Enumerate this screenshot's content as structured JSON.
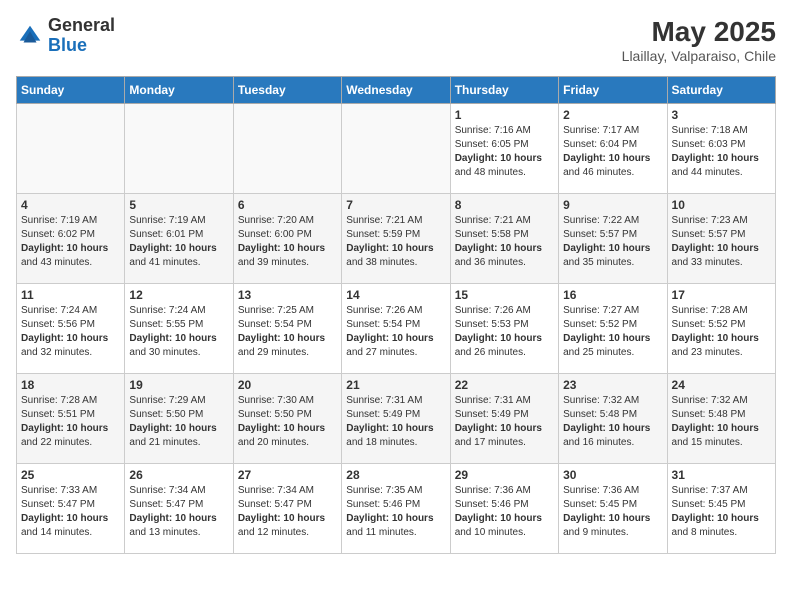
{
  "header": {
    "logo_general": "General",
    "logo_blue": "Blue",
    "title": "May 2025",
    "subtitle": "Llaillay, Valparaiso, Chile"
  },
  "weekdays": [
    "Sunday",
    "Monday",
    "Tuesday",
    "Wednesday",
    "Thursday",
    "Friday",
    "Saturday"
  ],
  "weeks": [
    [
      {
        "day": "",
        "info": ""
      },
      {
        "day": "",
        "info": ""
      },
      {
        "day": "",
        "info": ""
      },
      {
        "day": "",
        "info": ""
      },
      {
        "day": "1",
        "info": "Sunrise: 7:16 AM\nSunset: 6:05 PM\nDaylight: 10 hours\nand 48 minutes."
      },
      {
        "day": "2",
        "info": "Sunrise: 7:17 AM\nSunset: 6:04 PM\nDaylight: 10 hours\nand 46 minutes."
      },
      {
        "day": "3",
        "info": "Sunrise: 7:18 AM\nSunset: 6:03 PM\nDaylight: 10 hours\nand 44 minutes."
      }
    ],
    [
      {
        "day": "4",
        "info": "Sunrise: 7:19 AM\nSunset: 6:02 PM\nDaylight: 10 hours\nand 43 minutes."
      },
      {
        "day": "5",
        "info": "Sunrise: 7:19 AM\nSunset: 6:01 PM\nDaylight: 10 hours\nand 41 minutes."
      },
      {
        "day": "6",
        "info": "Sunrise: 7:20 AM\nSunset: 6:00 PM\nDaylight: 10 hours\nand 39 minutes."
      },
      {
        "day": "7",
        "info": "Sunrise: 7:21 AM\nSunset: 5:59 PM\nDaylight: 10 hours\nand 38 minutes."
      },
      {
        "day": "8",
        "info": "Sunrise: 7:21 AM\nSunset: 5:58 PM\nDaylight: 10 hours\nand 36 minutes."
      },
      {
        "day": "9",
        "info": "Sunrise: 7:22 AM\nSunset: 5:57 PM\nDaylight: 10 hours\nand 35 minutes."
      },
      {
        "day": "10",
        "info": "Sunrise: 7:23 AM\nSunset: 5:57 PM\nDaylight: 10 hours\nand 33 minutes."
      }
    ],
    [
      {
        "day": "11",
        "info": "Sunrise: 7:24 AM\nSunset: 5:56 PM\nDaylight: 10 hours\nand 32 minutes."
      },
      {
        "day": "12",
        "info": "Sunrise: 7:24 AM\nSunset: 5:55 PM\nDaylight: 10 hours\nand 30 minutes."
      },
      {
        "day": "13",
        "info": "Sunrise: 7:25 AM\nSunset: 5:54 PM\nDaylight: 10 hours\nand 29 minutes."
      },
      {
        "day": "14",
        "info": "Sunrise: 7:26 AM\nSunset: 5:54 PM\nDaylight: 10 hours\nand 27 minutes."
      },
      {
        "day": "15",
        "info": "Sunrise: 7:26 AM\nSunset: 5:53 PM\nDaylight: 10 hours\nand 26 minutes."
      },
      {
        "day": "16",
        "info": "Sunrise: 7:27 AM\nSunset: 5:52 PM\nDaylight: 10 hours\nand 25 minutes."
      },
      {
        "day": "17",
        "info": "Sunrise: 7:28 AM\nSunset: 5:52 PM\nDaylight: 10 hours\nand 23 minutes."
      }
    ],
    [
      {
        "day": "18",
        "info": "Sunrise: 7:28 AM\nSunset: 5:51 PM\nDaylight: 10 hours\nand 22 minutes."
      },
      {
        "day": "19",
        "info": "Sunrise: 7:29 AM\nSunset: 5:50 PM\nDaylight: 10 hours\nand 21 minutes."
      },
      {
        "day": "20",
        "info": "Sunrise: 7:30 AM\nSunset: 5:50 PM\nDaylight: 10 hours\nand 20 minutes."
      },
      {
        "day": "21",
        "info": "Sunrise: 7:31 AM\nSunset: 5:49 PM\nDaylight: 10 hours\nand 18 minutes."
      },
      {
        "day": "22",
        "info": "Sunrise: 7:31 AM\nSunset: 5:49 PM\nDaylight: 10 hours\nand 17 minutes."
      },
      {
        "day": "23",
        "info": "Sunrise: 7:32 AM\nSunset: 5:48 PM\nDaylight: 10 hours\nand 16 minutes."
      },
      {
        "day": "24",
        "info": "Sunrise: 7:32 AM\nSunset: 5:48 PM\nDaylight: 10 hours\nand 15 minutes."
      }
    ],
    [
      {
        "day": "25",
        "info": "Sunrise: 7:33 AM\nSunset: 5:47 PM\nDaylight: 10 hours\nand 14 minutes."
      },
      {
        "day": "26",
        "info": "Sunrise: 7:34 AM\nSunset: 5:47 PM\nDaylight: 10 hours\nand 13 minutes."
      },
      {
        "day": "27",
        "info": "Sunrise: 7:34 AM\nSunset: 5:47 PM\nDaylight: 10 hours\nand 12 minutes."
      },
      {
        "day": "28",
        "info": "Sunrise: 7:35 AM\nSunset: 5:46 PM\nDaylight: 10 hours\nand 11 minutes."
      },
      {
        "day": "29",
        "info": "Sunrise: 7:36 AM\nSunset: 5:46 PM\nDaylight: 10 hours\nand 10 minutes."
      },
      {
        "day": "30",
        "info": "Sunrise: 7:36 AM\nSunset: 5:45 PM\nDaylight: 10 hours\nand 9 minutes."
      },
      {
        "day": "31",
        "info": "Sunrise: 7:37 AM\nSunset: 5:45 PM\nDaylight: 10 hours\nand 8 minutes."
      }
    ]
  ]
}
